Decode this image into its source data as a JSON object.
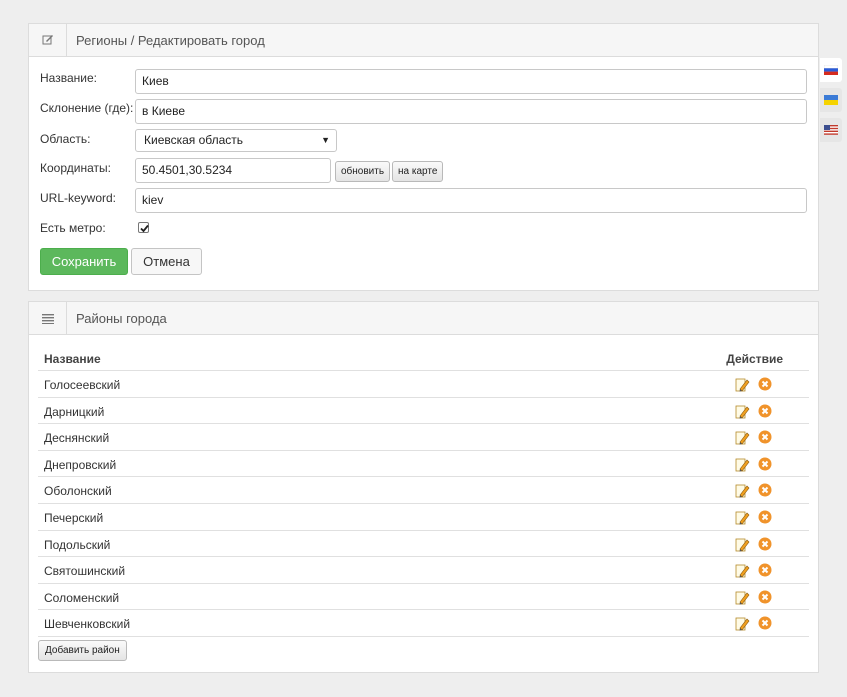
{
  "form_panel": {
    "title": "Регионы / Редактировать город",
    "fields": {
      "name": {
        "label": "Название:",
        "value": "Киев"
      },
      "declension": {
        "label": "Склонение (где):",
        "value": "в Киеве"
      },
      "region": {
        "label": "Область:",
        "value": "Киевская область"
      },
      "coords": {
        "label": "Координаты:",
        "value": "50.4501,30.5234",
        "update_label": "обновить",
        "map_label": "на карте"
      },
      "url_keyword": {
        "label": "URL-keyword:",
        "value": "kiev"
      },
      "metro": {
        "label": "Есть метро:",
        "checked": true
      }
    },
    "save_label": "Сохранить",
    "cancel_label": "Отмена"
  },
  "districts_panel": {
    "title": "Районы города",
    "col_name": "Название",
    "col_action": "Действие",
    "rows": [
      "Голосеевский",
      "Дарницкий",
      "Деснянский",
      "Днепровский",
      "Оболонский",
      "Печерский",
      "Подольский",
      "Святошинский",
      "Соломенский",
      "Шевченковский"
    ],
    "add_label": "Добавить район"
  },
  "languages": [
    "ru-flag-icon",
    "ua-flag-icon",
    "us-flag-icon"
  ],
  "colors": {
    "save": "#5cb85c",
    "delete": "#f0932b",
    "edit": "#e8a317"
  }
}
